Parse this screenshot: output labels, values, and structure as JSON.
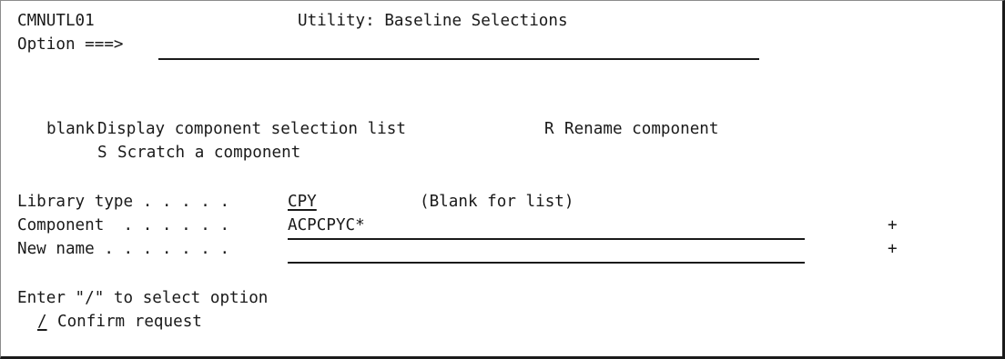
{
  "header": {
    "panel_id": "CMNUTL01",
    "title": "Utility: Baseline Selections"
  },
  "option": {
    "label": "Option ===>",
    "value": ""
  },
  "actions": {
    "blank_code": "blank",
    "blank_desc": "Display component selection list",
    "r_code": "R",
    "r_desc": "Rename component",
    "s_code": "S",
    "s_desc": "Scratch a component"
  },
  "fields": {
    "library_type": {
      "label": "Library type . . . . .",
      "value": "CPY",
      "hint": "(Blank for list)"
    },
    "component": {
      "label": "Component  . . . . . .",
      "value": "ACPCPYC*",
      "prompt": "+"
    },
    "new_name": {
      "label": "New name . . . . . . .",
      "value": "",
      "prompt": "+"
    }
  },
  "confirm": {
    "instruction": "Enter \"/\" to select option",
    "mark": "/",
    "label": "Confirm request"
  }
}
